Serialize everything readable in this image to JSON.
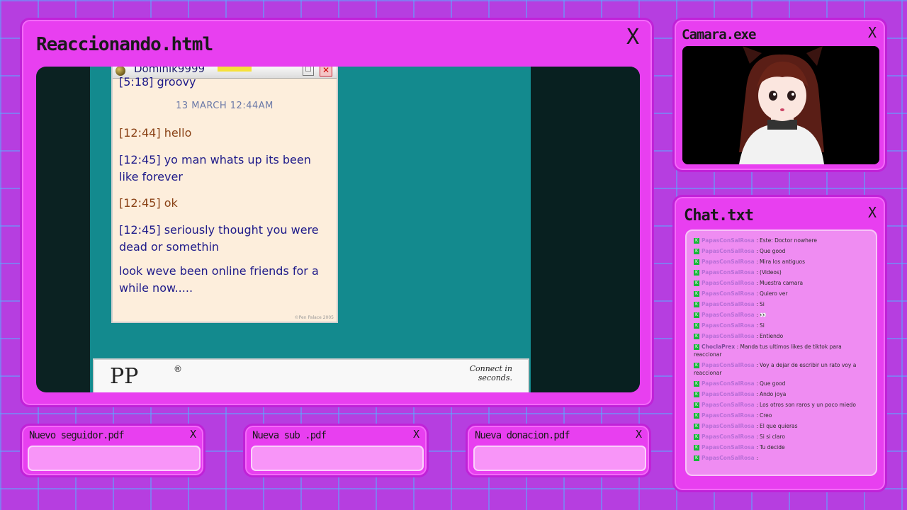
{
  "main_window": {
    "title": "Reaccionando.html",
    "close_glyph": "X",
    "chat": {
      "username": "Dominik9999",
      "close_glyph": "✕",
      "messages": [
        {
          "time": "[5:18]",
          "text": "groovy",
          "color": "blue"
        },
        {
          "time": "[12:44]",
          "text": "hello",
          "color": "brown"
        },
        {
          "time": "[12:45]",
          "text": "yo man whats up its been like forever",
          "color": "blue"
        },
        {
          "time": "[12:45]",
          "text": "ok",
          "color": "brown"
        },
        {
          "time": "[12:45]",
          "text": "seriously thought you were dead or somethin",
          "color": "blue"
        },
        {
          "time": "",
          "text": "look weve been online friends for a while now.....",
          "color": "blue"
        }
      ],
      "date_separator": "13 MARCH 12:44AM",
      "copyright": "©Pen Palace 2005"
    },
    "ad": {
      "logo_text": "PP",
      "registered": "®",
      "text": "Connect in seconds."
    }
  },
  "camera_window": {
    "title": "Camara.exe",
    "close_glyph": "X"
  },
  "chat_window": {
    "title": "Chat.txt",
    "close_glyph": "X",
    "lines": [
      {
        "user": "PapasConSalRosa",
        "text": "Este: Doctor nowhere"
      },
      {
        "user": "PapasConSalRosa",
        "text": "Que good"
      },
      {
        "user": "PapasConSalRosa",
        "text": "Mira los antiguos"
      },
      {
        "user": "PapasConSalRosa",
        "text": "(Videos)"
      },
      {
        "user": "PapasConSalRosa",
        "text": "Muestra camara"
      },
      {
        "user": "PapasConSalRosa",
        "text": "Quiero ver"
      },
      {
        "user": "PapasConSalRosa",
        "text": "Si"
      },
      {
        "user": "PapasConSalRosa",
        "text": "👀"
      },
      {
        "user": "PapasConSalRosa",
        "text": "Si"
      },
      {
        "user": "PapasConSalRosa",
        "text": "Entiendo"
      },
      {
        "user": "ChoclaPrex",
        "text": "Manda tus ultimos likes de tiktok para reaccionar",
        "alt": true
      },
      {
        "user": "PapasConSalRosa",
        "text": "Voy a dejar de escribir un rato voy a reaccionar"
      },
      {
        "user": "PapasConSalRosa",
        "text": "Que good"
      },
      {
        "user": "PapasConSalRosa",
        "text": "Ando joya"
      },
      {
        "user": "PapasConSalRosa",
        "text": "Los otros son raros y un poco miedo"
      },
      {
        "user": "PapasConSalRosa",
        "text": "Creo"
      },
      {
        "user": "PapasConSalRosa",
        "text": "El que quieras"
      },
      {
        "user": "PapasConSalRosa",
        "text": "Si si claro"
      },
      {
        "user": "PapasConSalRosa",
        "text": "Tu decide"
      },
      {
        "user": "PapasConSalRosa",
        "text": ""
      }
    ]
  },
  "alerts": [
    {
      "title": "Nuevo seguidor.pdf",
      "close_glyph": "X"
    },
    {
      "title": "Nueva sub .pdf",
      "close_glyph": "X"
    },
    {
      "title": "Nueva donacion.pdf",
      "close_glyph": "X"
    }
  ]
}
